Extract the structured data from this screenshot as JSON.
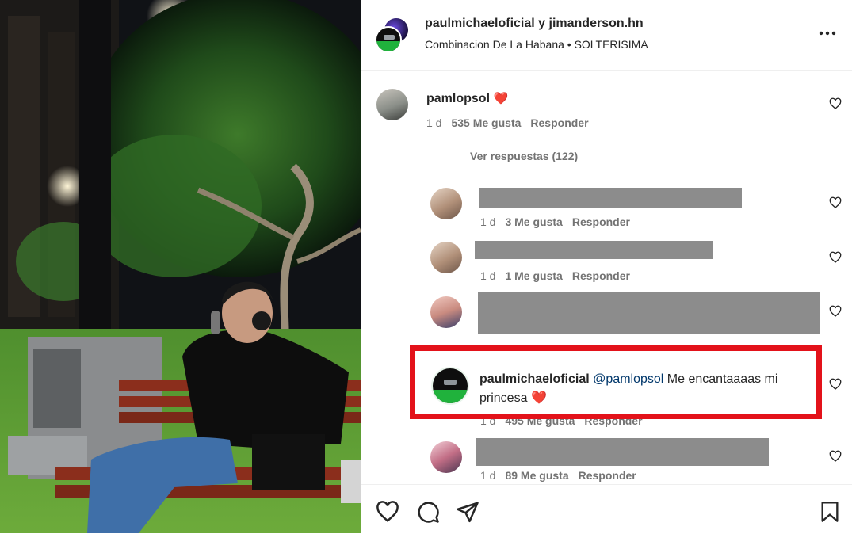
{
  "post": {
    "authors": "paulmichaeloficial y jimanderson.hn",
    "audio": "Combinacion De La Habana • SOLTERISIMA",
    "more_icon": "more-horizontal-icon"
  },
  "main_comment": {
    "username": "pamlopsol",
    "emoji": "❤️",
    "age": "1 d",
    "likes": "535 Me gusta",
    "reply": "Responder"
  },
  "view_replies": "Ver respuestas (122)",
  "replies": [
    {
      "age": "1 d",
      "likes": "3 Me gusta",
      "reply": "Responder"
    },
    {
      "age": "1 d",
      "likes": "1 Me gusta",
      "reply": "Responder"
    },
    {
      "username": "paulmichaeloficial",
      "mention": "@pamlopsol",
      "text_line1": "Me encantaaaas mi",
      "text_line2": "princesa",
      "emoji": "❤️",
      "age": "1 d",
      "likes": "495 Me gusta",
      "reply": "Responder"
    },
    {
      "age": "1 d",
      "likes": "89 Me gusta",
      "reply": "Responder"
    }
  ],
  "colors": {
    "highlight_border": "#e3121a",
    "redaction": "#8c8c8c",
    "heart": "#ed4956",
    "muted_text": "#737373"
  },
  "footer_icons": [
    "heart-icon",
    "comment-icon",
    "share-icon",
    "save-icon"
  ]
}
